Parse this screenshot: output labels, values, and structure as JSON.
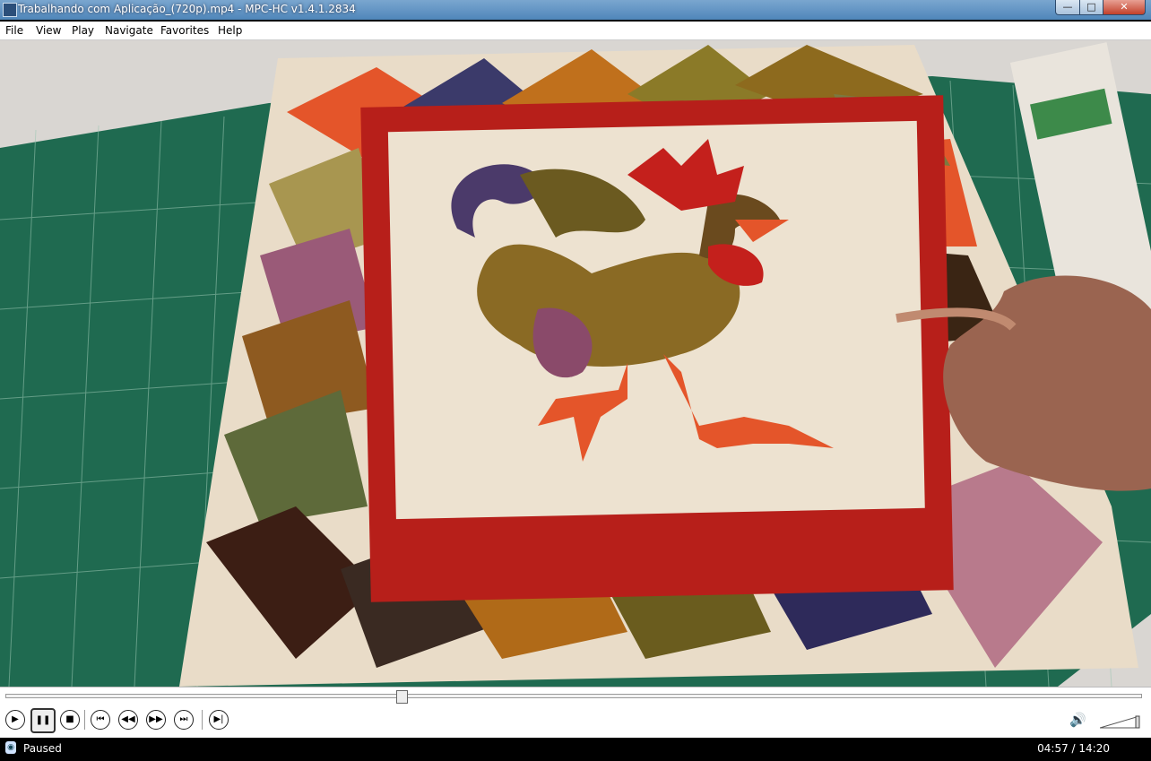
{
  "window": {
    "title": "Trabalhando com Aplicação_(720p).mp4 - MPC-HC v1.4.1.2834",
    "minimize_label": "—",
    "maximize_label": "□",
    "close_label": "✕"
  },
  "menu": {
    "items": [
      "File",
      "View",
      "Play",
      "Navigate",
      "Favorites",
      "Help"
    ]
  },
  "seek": {
    "progress": 0.348
  },
  "controls": {
    "play_icon": "play-icon",
    "pause_icon": "pause-icon",
    "stop_icon": "stop-icon",
    "prev_icon": "skip-back-icon",
    "rewind_icon": "rewind-icon",
    "forward_icon": "fast-forward-icon",
    "next_icon": "skip-forward-icon",
    "frame_step_icon": "frame-step-icon",
    "volume_icon": "speaker-icon"
  },
  "status": {
    "state": "Paused",
    "time": "04:57 / 14:20"
  },
  "colors": {
    "accent_volume": "#2d9b2d",
    "quilt_red": "#b71f1a",
    "quilt_orange": "#e4552a",
    "cutting_mat": "#1f6a50"
  }
}
